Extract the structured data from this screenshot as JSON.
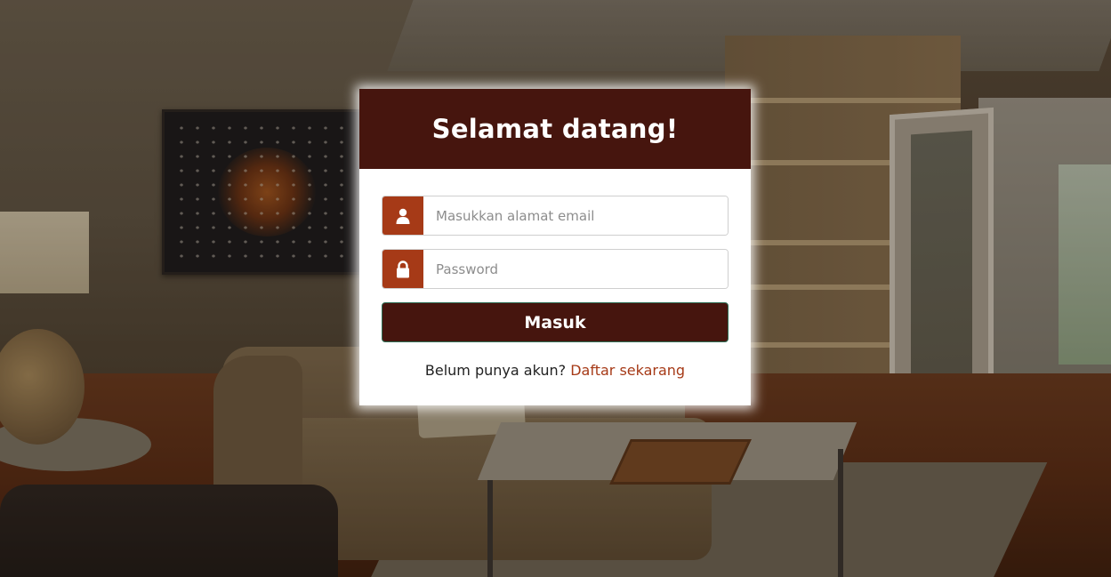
{
  "login": {
    "title": "Selamat datang!",
    "email": {
      "placeholder": "Masukkan alamat email",
      "value": "",
      "icon": "user-icon"
    },
    "password": {
      "placeholder": "Password",
      "value": "",
      "icon": "lock-icon"
    },
    "submit_label": "Masuk",
    "register_prompt": "Belum punya akun?",
    "register_link": "Daftar sekarang"
  },
  "colors": {
    "header_bg": "#46150e",
    "icon_bg": "#a63a17",
    "link": "#a63a17",
    "button_bg": "#46150e"
  }
}
